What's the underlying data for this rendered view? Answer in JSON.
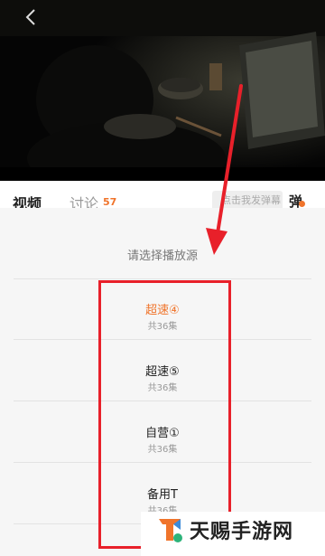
{
  "player": {
    "back_icon": "chevron-left-icon"
  },
  "tabs": {
    "video_label": "视频",
    "discuss_label": "讨论",
    "discuss_count": "57",
    "danmaku_placeholder": "点击我发弹幕",
    "danmaku_label": "弹"
  },
  "sheet": {
    "title": "请选择播放源",
    "sources": [
      {
        "name": "超速④",
        "episodes": "共36集",
        "active": true
      },
      {
        "name": "超速⑤",
        "episodes": "共36集",
        "active": false
      },
      {
        "name": "自营①",
        "episodes": "共36集",
        "active": false
      },
      {
        "name": "备用T",
        "episodes": "共36集",
        "active": false
      }
    ]
  },
  "colors": {
    "accent": "#f0742b",
    "annotation": "#e8202a"
  },
  "watermark": {
    "text": "天赐手游网"
  }
}
